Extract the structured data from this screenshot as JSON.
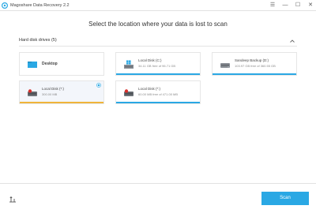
{
  "window": {
    "title": "Magoshare Data Recovery 2.2",
    "controls": {
      "menu": "☰",
      "minimize": "—",
      "maximize": "☐",
      "close": "✕"
    }
  },
  "heading": "Select the location where your data is lost to scan",
  "section": {
    "title": "Hard disk drives (5)"
  },
  "drives": [
    {
      "name": "Desktop",
      "free_text": "",
      "icon": "desktop-folder-icon",
      "usage_fraction": 0,
      "selected": false
    },
    {
      "name": "Local Disk (C:)",
      "free_text": "34.11 GB free of 96.71 GB",
      "icon": "windows-drive-icon",
      "usage_fraction": 1.0,
      "selected": false
    },
    {
      "name": "Sandeep Backup (D:)",
      "free_text": "103.97 GB free of 360.55 GB",
      "icon": "hard-drive-icon",
      "usage_fraction": 1.0,
      "selected": false
    },
    {
      "name": "Local Disk (*:)",
      "free_text": "300.00 MB",
      "icon": "hard-drive-red-icon",
      "usage_fraction": 1.0,
      "selected": true
    },
    {
      "name": "Local Disk (*:)",
      "free_text": "60.00 MB free of 471.00 MB",
      "icon": "hard-drive-red-icon",
      "usage_fraction": 1.0,
      "selected": false
    }
  ],
  "footer": {
    "scan_label": "Scan",
    "tool_icon": "history-icon"
  },
  "colors": {
    "accent": "#2aa8e4",
    "selected_bar": "#f0b43a",
    "drive_red": "#d9302c"
  }
}
